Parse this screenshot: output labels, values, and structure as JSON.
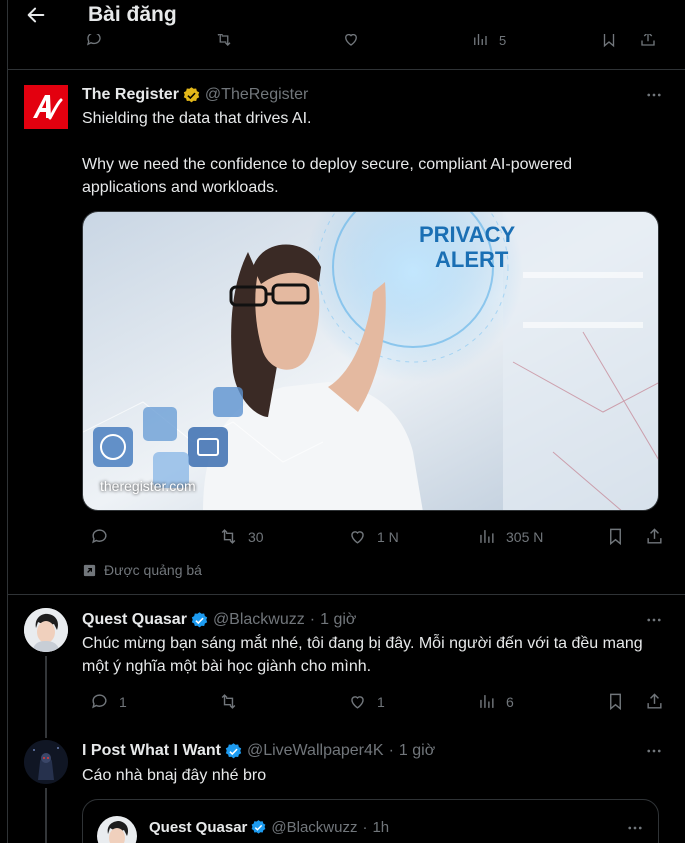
{
  "header": {
    "title": "Bài đăng"
  },
  "top_actions": {
    "views": "5"
  },
  "ad_post": {
    "name": "The Register",
    "handle": "@TheRegister",
    "text_line1": "Shielding the data that drives AI.",
    "text_line2": "Why we need the confidence to deploy secure, compliant AI-powered applications and workloads.",
    "media_headline_1": "PRIVACY",
    "media_headline_2": "ALERT",
    "media_url": "theregister.com",
    "reposts": "30",
    "likes": "1 N",
    "views": "305 N",
    "promoted_label": "Được quảng bá"
  },
  "reply_1": {
    "name": "Quest Quasar",
    "handle": "@Blackwuzz",
    "dot": "·",
    "time": "1 giờ",
    "text": "Chúc mừng bạn sáng mắt nhé, tôi đang bị đây. Mỗi người đến với ta đều mang một ý nghĩa một bài học giành cho mình.",
    "replies": "1",
    "likes": "1",
    "views": "6"
  },
  "reply_2": {
    "name": "I Post What I Want",
    "handle": "@LiveWallpaper4K",
    "dot": "·",
    "time": "1 giờ",
    "text": "Cáo nhà bnaj đây nhé bro"
  },
  "quoted": {
    "name": "Quest Quasar",
    "handle": "@Blackwuzz",
    "dot": "·",
    "time": "1h"
  },
  "colors": {
    "background": "#000000",
    "text": "#e7e9ea",
    "muted": "#71767b",
    "border": "#2f3336",
    "gold_badge": "#e2b719",
    "blue_badge": "#1d9bf0",
    "register_red": "#e3000f"
  }
}
